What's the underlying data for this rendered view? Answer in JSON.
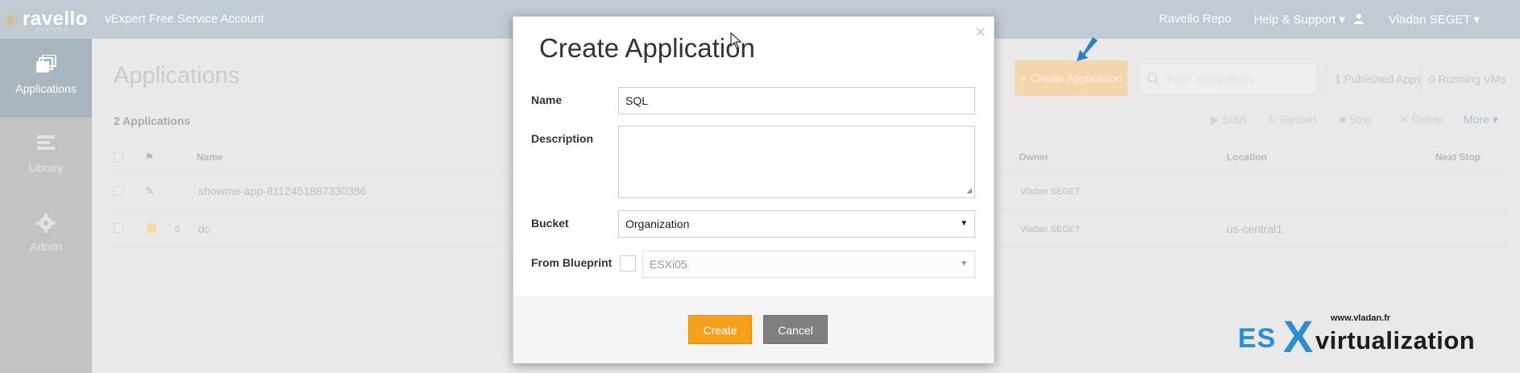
{
  "topbar": {
    "logo_text": "ravello",
    "logo_sub": "SYSTEMS",
    "account": "vExpert Free Service Account",
    "nav": {
      "repo": "Ravello Repo",
      "help": "Help & Support ▾",
      "user": "Vladan SEGET ▾"
    }
  },
  "sidebar": {
    "items": [
      {
        "label": "Applications",
        "icon": "applications-icon",
        "active": true
      },
      {
        "label": "Library",
        "icon": "library-icon",
        "active": false
      },
      {
        "label": "Admin",
        "icon": "gear-icon",
        "active": false
      }
    ]
  },
  "main": {
    "title": "Applications",
    "count": "2 Applications",
    "create_button": "+ Create Application",
    "search_placeholder": "Filter applications",
    "published_apps": "1 Published Apps",
    "running_vms": "0 Running VMs",
    "actions": {
      "start": "▶ Start",
      "restart": "↻ Restart",
      "stop": "■ Stop",
      "delete": "✕ Delete",
      "more": "More ▾"
    },
    "columns": {
      "name": "Name",
      "owner": "Owner",
      "location": "Location",
      "next_stop": "Next Stop"
    },
    "rows": [
      {
        "status": "",
        "name": "showme-app-8112451887330386",
        "owner": "Vladan SEGET",
        "location": ""
      },
      {
        "status": "0",
        "name": "dc",
        "owner": "Vladan SEGET",
        "location": "us-central1"
      }
    ]
  },
  "modal": {
    "title": "Create Application",
    "close": "×",
    "name_label": "Name",
    "name_value": "SQL",
    "description_label": "Description",
    "description_value": "",
    "bucket_label": "Bucket",
    "bucket_value": "Organization",
    "blueprint_label": "From Blueprint",
    "blueprint_value": "ESXi05",
    "create_button": "Create",
    "cancel_button": "Cancel"
  },
  "watermark": {
    "url": "www.vladan.fr",
    "es": "ES",
    "x": "X",
    "rest": "virtualization"
  },
  "colors": {
    "topbar": "#bfcad3",
    "accent_orange": "#f5a01a",
    "cancel_gray": "#808080",
    "watermark_blue": "#2a8fd0"
  }
}
